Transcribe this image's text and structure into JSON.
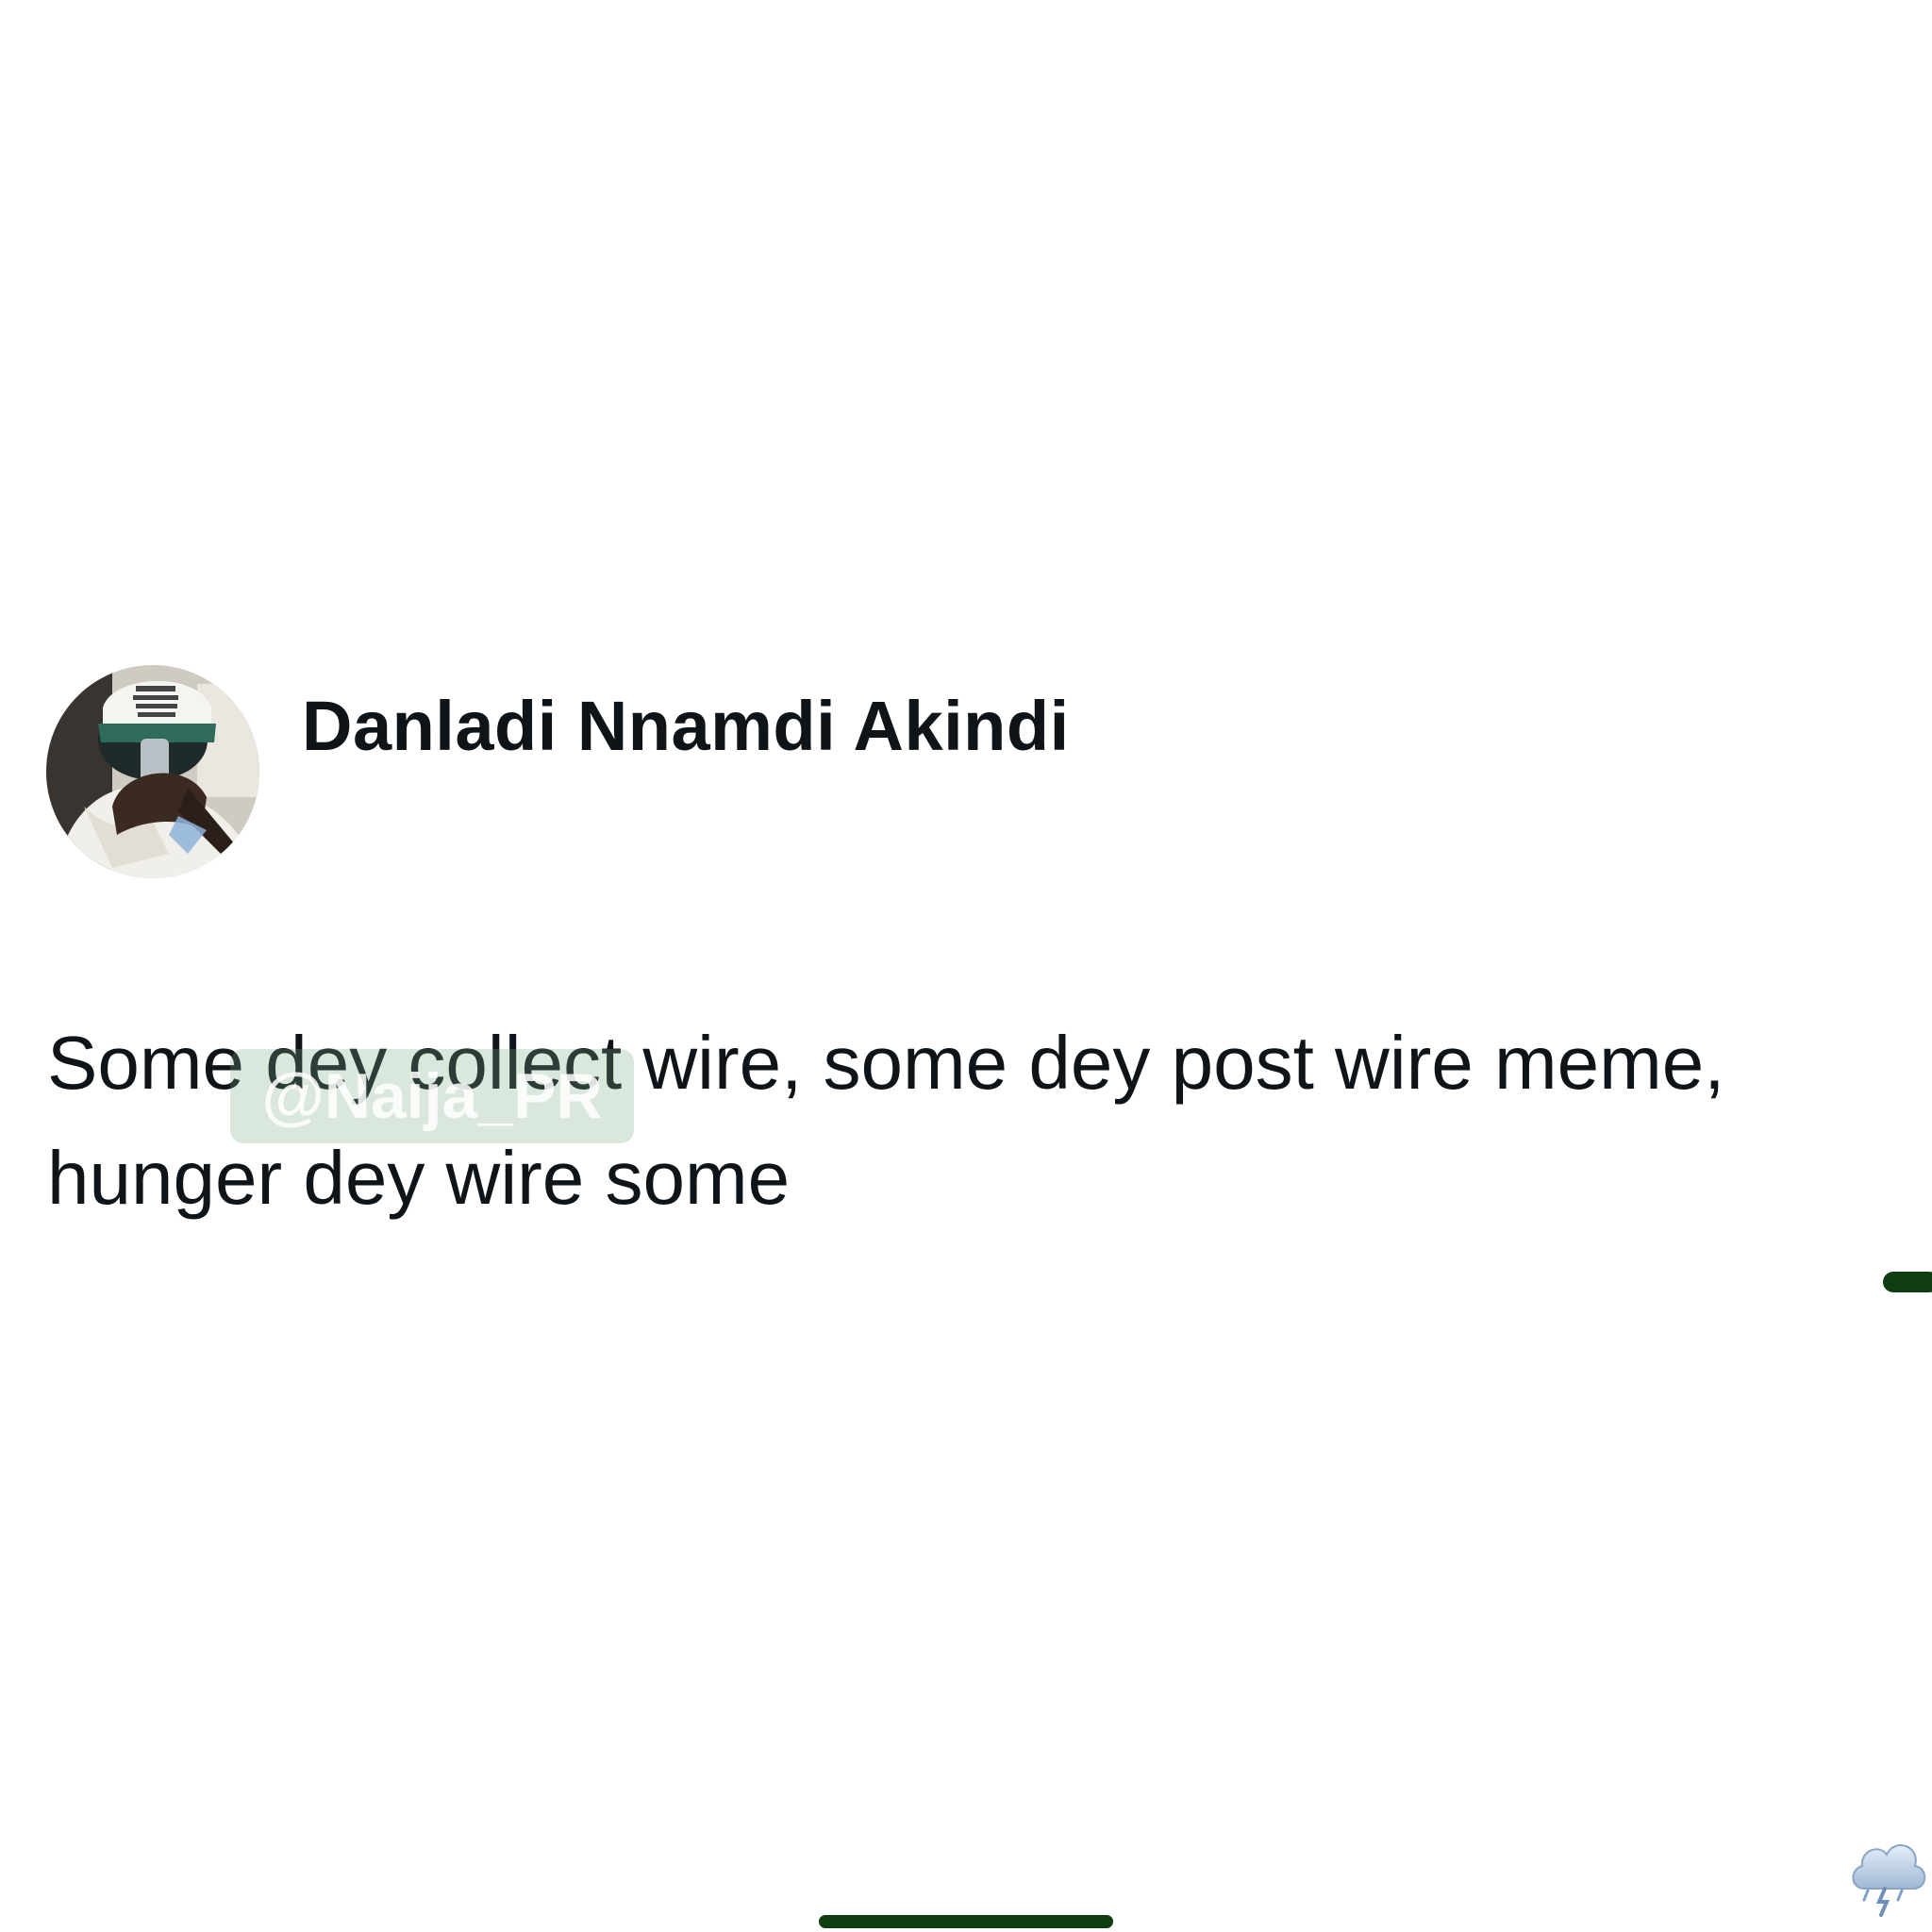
{
  "tweet": {
    "author": {
      "display_name": "Danladi Nnamdi Akindi",
      "avatar_icon": "profile-photo"
    },
    "text": "Some dey collect wire, some dey post wire meme, hunger dey wire some"
  },
  "watermark": {
    "text": "@Naija_PR"
  },
  "colors": {
    "text": "#0f1419",
    "accent_green": "#0e3d12",
    "background": "#ffffff"
  },
  "decor": {
    "corner_icon": "storm-cloud-icon"
  }
}
